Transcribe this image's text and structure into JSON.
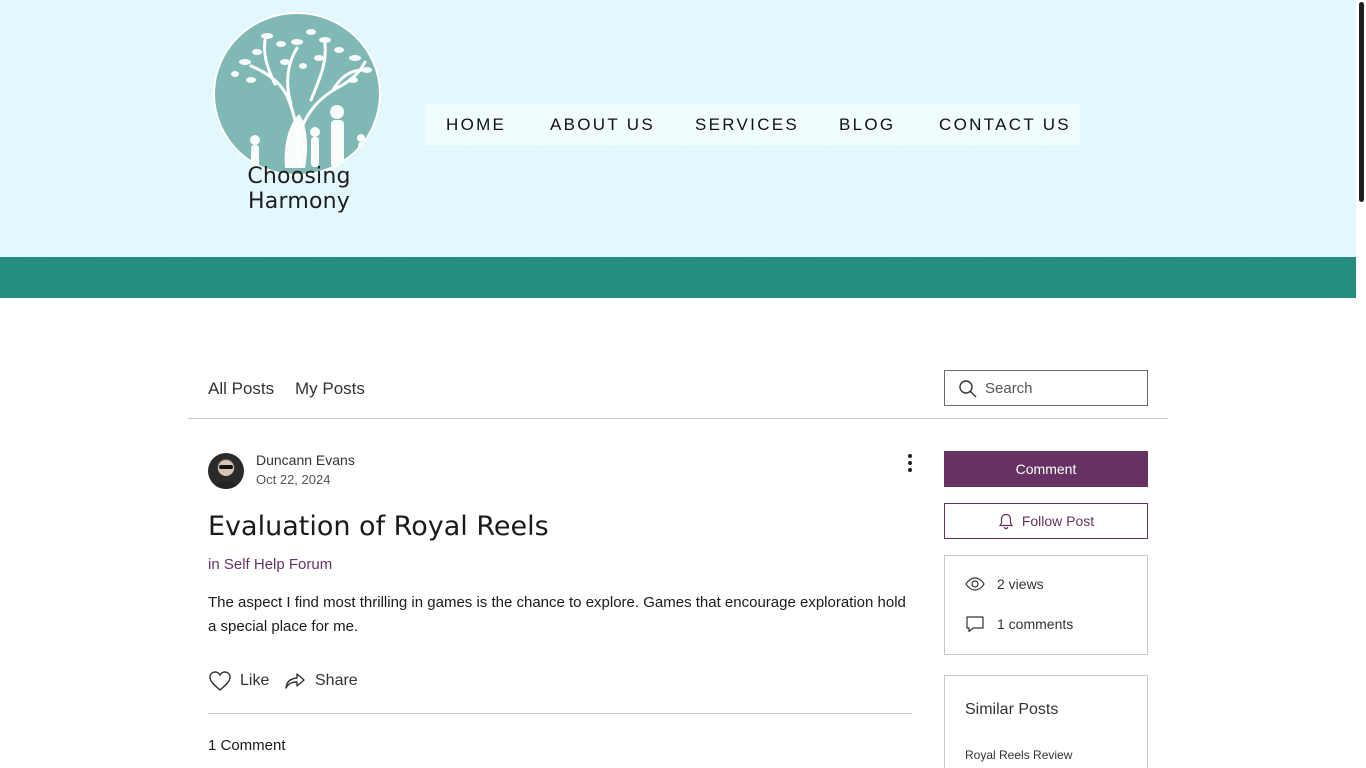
{
  "site": {
    "logo_text": "Choosing Harmony",
    "nav": [
      "HOME",
      "ABOUT US",
      "SERVICES",
      "BLOG",
      "CONTACT US"
    ],
    "colors": {
      "header_bg": "#e2f8fc",
      "teal_band": "#258e80",
      "accent_purple": "#653263",
      "logo_teal": "#7fb8b4"
    }
  },
  "blog_nav": {
    "tabs": [
      "All Posts",
      "My Posts"
    ],
    "search_placeholder": "Search",
    "search_icon": "search-icon"
  },
  "post": {
    "author": "Duncann Evans",
    "date": "Oct 22, 2024",
    "title": "Evaluation of Royal Reels",
    "category": "in Self Help Forum",
    "body": "The aspect I find most thrilling in games is the chance to explore. Games that encourage exploration hold a special place for me.",
    "like_label": "Like",
    "share_label": "Share",
    "comments_count": "1 Comment"
  },
  "sidebar": {
    "comment_button": "Comment",
    "follow_button": "Follow Post",
    "views": "2 views",
    "comments": "1 comments",
    "similar_heading": "Similar Posts",
    "similar_items": [
      "Royal Reels Review"
    ]
  },
  "icons": {
    "more": "more-vertical-icon",
    "like": "heart-icon",
    "share": "share-arrow-icon",
    "follow": "bell-icon",
    "views": "eye-icon",
    "comments": "comment-bubble-icon"
  }
}
